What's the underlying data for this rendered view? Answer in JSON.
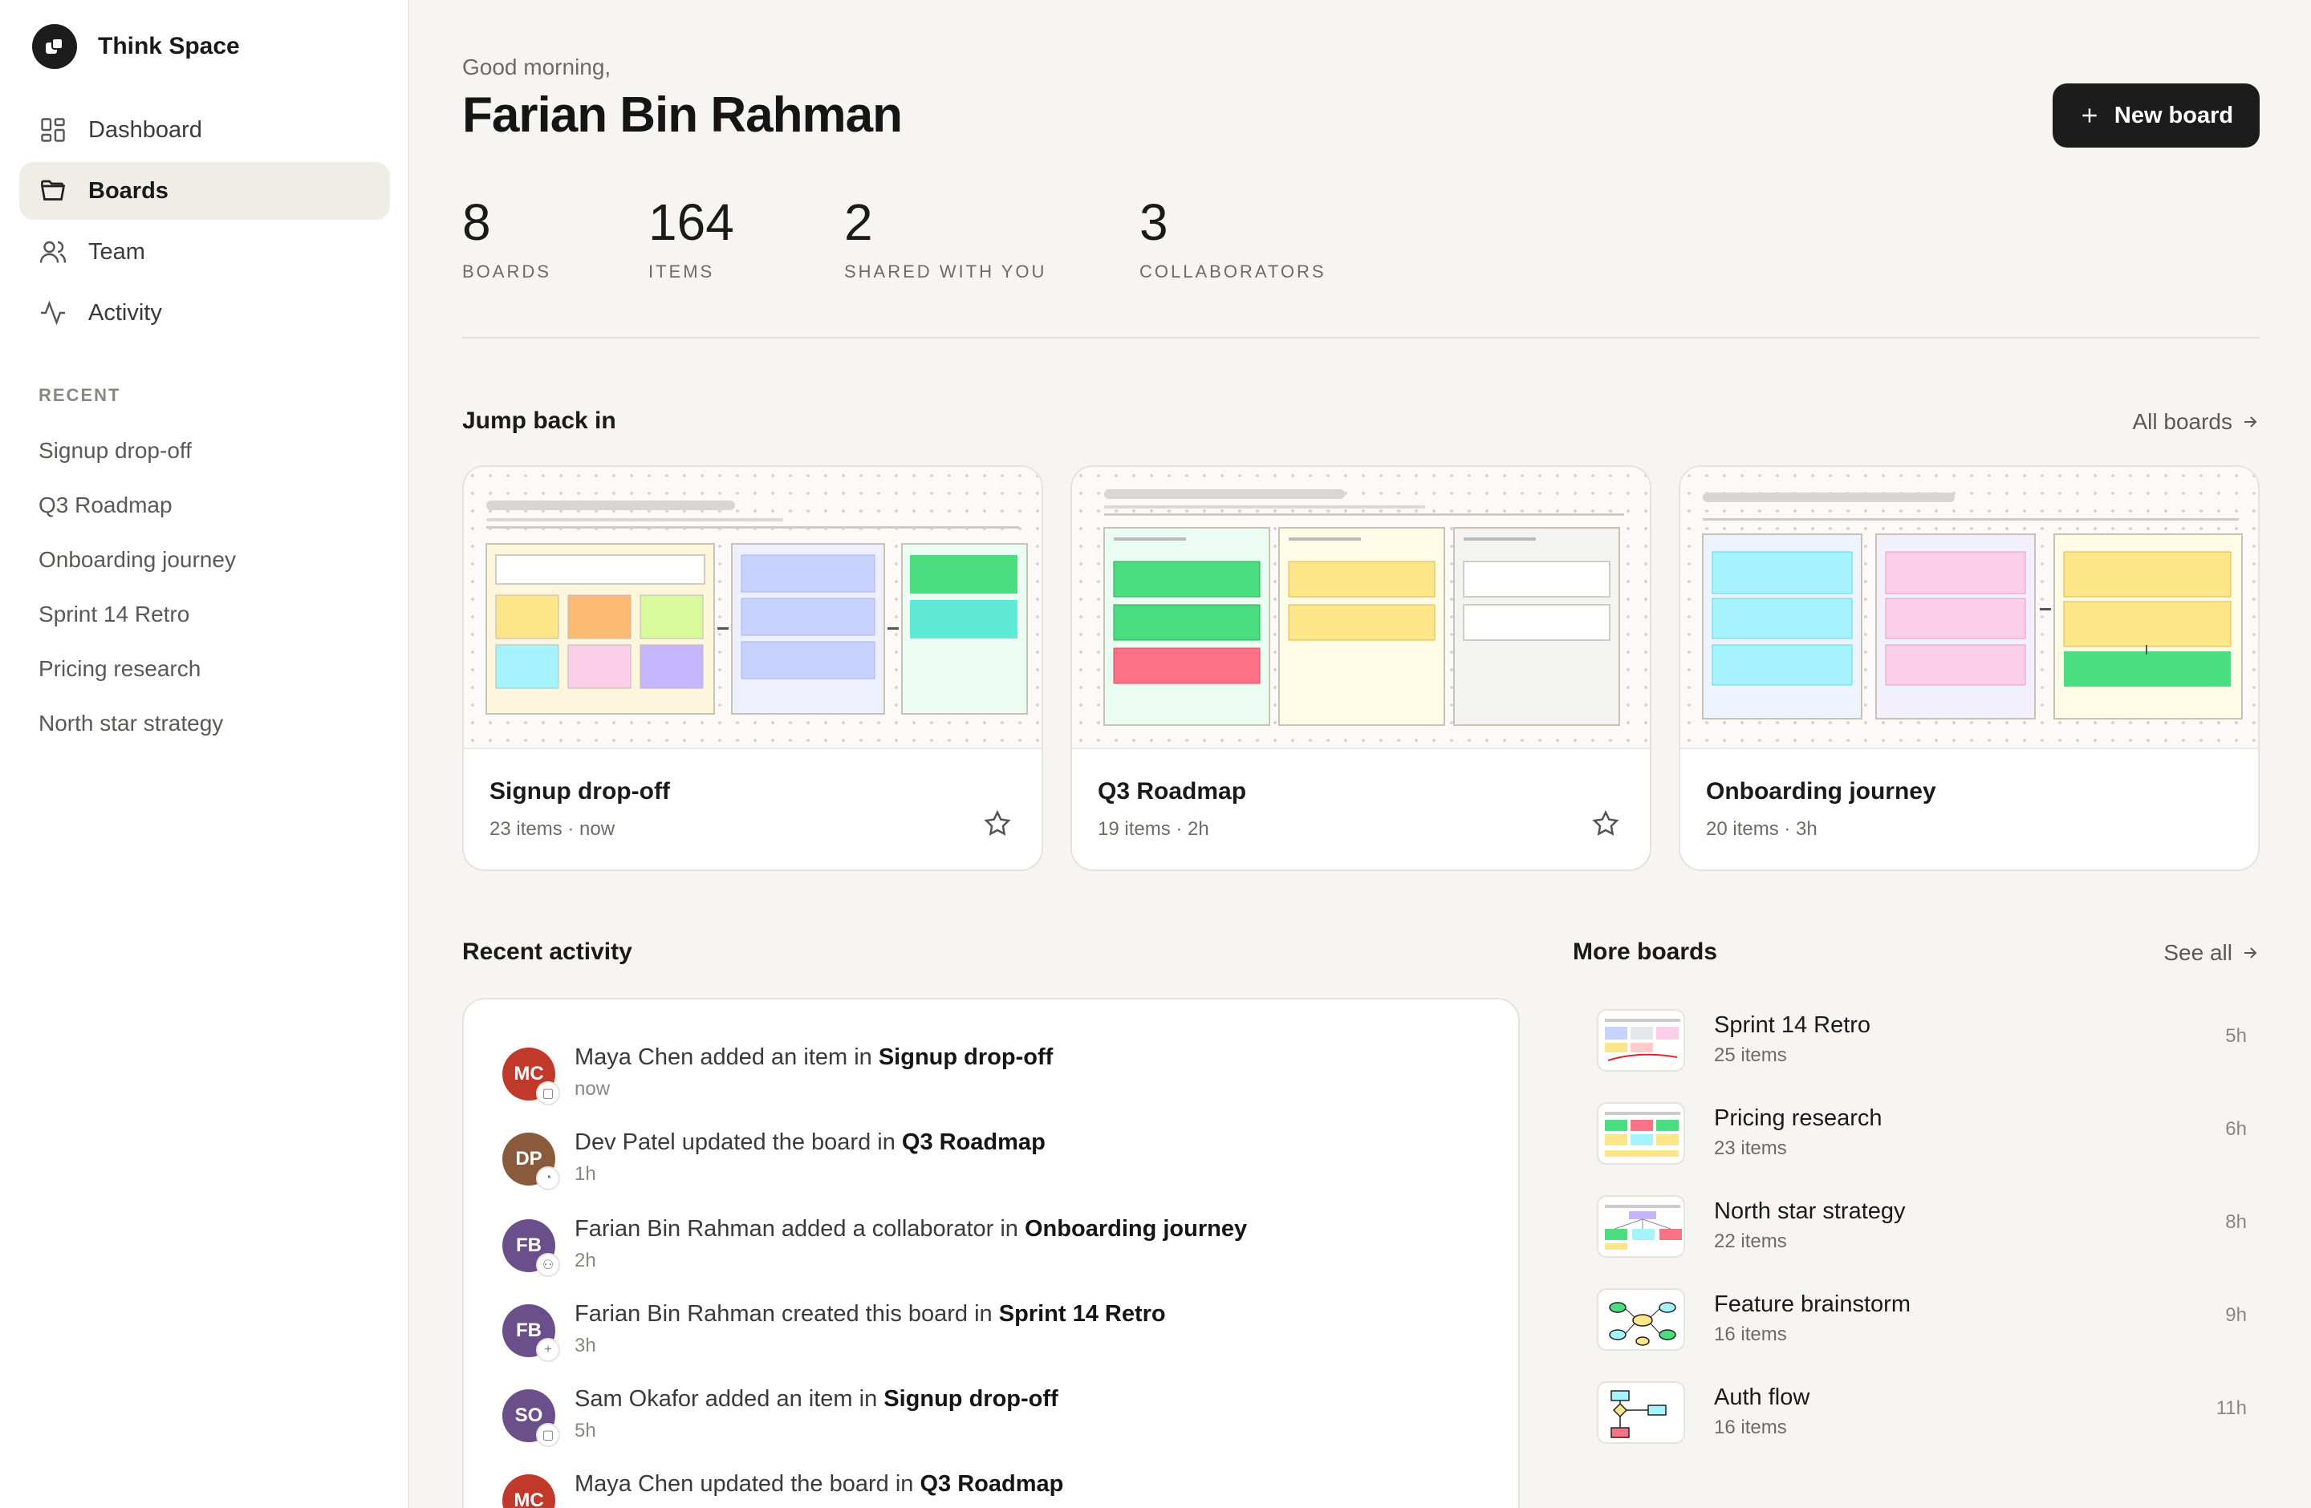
{
  "brand": {
    "name": "Think Space"
  },
  "nav": [
    {
      "label": "Dashboard",
      "icon": "grid-icon"
    },
    {
      "label": "Boards",
      "icon": "folder-icon",
      "active": true
    },
    {
      "label": "Team",
      "icon": "users-icon"
    },
    {
      "label": "Activity",
      "icon": "activity-icon"
    }
  ],
  "recent": {
    "heading": "RECENT",
    "items": [
      "Signup drop-off",
      "Q3 Roadmap",
      "Onboarding journey",
      "Sprint 14 Retro",
      "Pricing research",
      "North star strategy"
    ]
  },
  "header": {
    "greeting": "Good morning,",
    "name": "Farian Bin Rahman",
    "new_board_label": "New board"
  },
  "stats": [
    {
      "value": "8",
      "label": "BOARDS"
    },
    {
      "value": "164",
      "label": "ITEMS"
    },
    {
      "value": "2",
      "label": "SHARED WITH YOU"
    },
    {
      "value": "3",
      "label": "COLLABORATORS"
    }
  ],
  "jump_back": {
    "title": "Jump back in",
    "link": "All boards",
    "cards": [
      {
        "title": "Signup drop-off",
        "meta": "23 items · now",
        "starred_icon": true
      },
      {
        "title": "Q3 Roadmap",
        "meta": "19 items · 2h",
        "starred_icon": true
      },
      {
        "title": "Onboarding journey",
        "meta": "20 items · 3h",
        "starred_icon": false
      }
    ]
  },
  "activity": {
    "title": "Recent activity",
    "items": [
      {
        "initials": "MC",
        "color": "#c0392b",
        "text": "Maya Chen added an item in ",
        "board": "Signup drop-off",
        "time": "now",
        "badge": "▢"
      },
      {
        "initials": "DP",
        "color": "#8a5a3c",
        "text": "Dev Patel updated the board in ",
        "board": "Q3 Roadmap",
        "time": "1h",
        "badge": "◔"
      },
      {
        "initials": "FB",
        "color": "#6b4f8a",
        "text": "Farian Bin Rahman added a collaborator in ",
        "board": "Onboarding journey",
        "time": "2h",
        "badge": "⚇"
      },
      {
        "initials": "FB",
        "color": "#6b4f8a",
        "text": "Farian Bin Rahman created this board in ",
        "board": "Sprint 14 Retro",
        "time": "3h",
        "badge": "+"
      },
      {
        "initials": "SO",
        "color": "#6b4f8a",
        "text": "Sam Okafor added an item in ",
        "board": "Signup drop-off",
        "time": "5h",
        "badge": "▢"
      },
      {
        "initials": "MC",
        "color": "#c0392b",
        "text": "Maya Chen updated the board in ",
        "board": "Q3 Roadmap",
        "time": "",
        "badge": ""
      }
    ]
  },
  "more_boards": {
    "title": "More boards",
    "link": "See all",
    "items": [
      {
        "name": "Sprint 14 Retro",
        "count": "25 items",
        "time": "5h"
      },
      {
        "name": "Pricing research",
        "count": "23 items",
        "time": "6h"
      },
      {
        "name": "North star strategy",
        "count": "22 items",
        "time": "8h"
      },
      {
        "name": "Feature brainstorm",
        "count": "16 items",
        "time": "9h"
      },
      {
        "name": "Auth flow",
        "count": "16 items",
        "time": "11h"
      }
    ]
  }
}
